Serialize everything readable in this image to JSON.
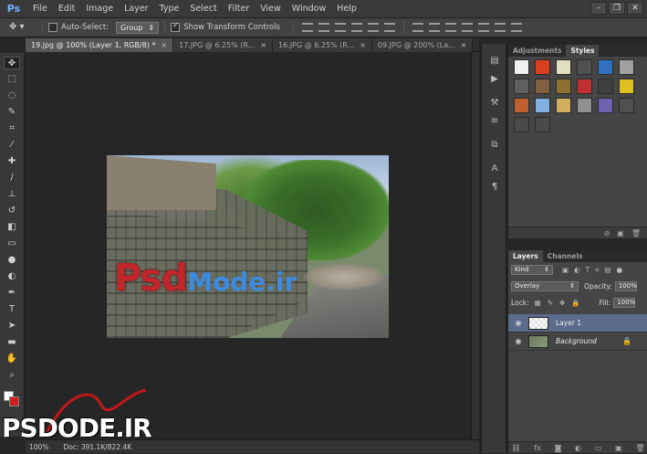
{
  "menubar": {
    "logo": "Ps",
    "items": [
      "File",
      "Edit",
      "Image",
      "Layer",
      "Type",
      "Select",
      "Filter",
      "View",
      "Window",
      "Help"
    ],
    "window_controls": [
      "–",
      "❐",
      "✕"
    ]
  },
  "options": {
    "auto_select_label": "Auto-Select:",
    "auto_select_mode": "Group",
    "show_transform_label": "Show Transform Controls"
  },
  "tabs": [
    {
      "label": "19.jpg @ 100% (Layer 1, RGB/8) *",
      "active": true
    },
    {
      "label": "17.JPG @ 6.25% (R...",
      "active": false
    },
    {
      "label": "16.JPG @ 6.25% (R...",
      "active": false
    },
    {
      "label": "09.JPG @ 200% (La...",
      "active": false
    }
  ],
  "canvas": {
    "overlay_text_red": "Psd",
    "overlay_text_blue": "Mode.ir"
  },
  "status": {
    "zoom": "100%",
    "doc": "Doc: 391.1K/822.4K"
  },
  "styles_panel": {
    "tab_adjustments": "Adjustments",
    "tab_styles": "Styles",
    "swatches": [
      "#f0f0f0",
      "#d84020",
      "#e0e0c0",
      "#505050",
      "#3070c0",
      "#a0a0a0",
      "#606060",
      "#806040",
      "#907030",
      "#c03030",
      "#404040",
      "#e0c020",
      "#c06030",
      "#80b0e0",
      "#d0b060",
      "#909090",
      "#7060b0",
      "#505050",
      "#4a4a4a",
      "#4a4a4a"
    ]
  },
  "layers_panel": {
    "tab_layers": "Layers",
    "tab_channels": "Channels",
    "kind_label": "Kind",
    "blend_mode": "Overlay",
    "opacity_label": "Opacity:",
    "opacity_value": "100%",
    "lock_label": "Lock:",
    "fill_label": "Fill:",
    "fill_value": "100%",
    "layers": [
      {
        "name": "Layer 1",
        "selected": true
      },
      {
        "name": "Background",
        "selected": false
      }
    ]
  },
  "watermark": {
    "text": "PSDODE.IR"
  }
}
